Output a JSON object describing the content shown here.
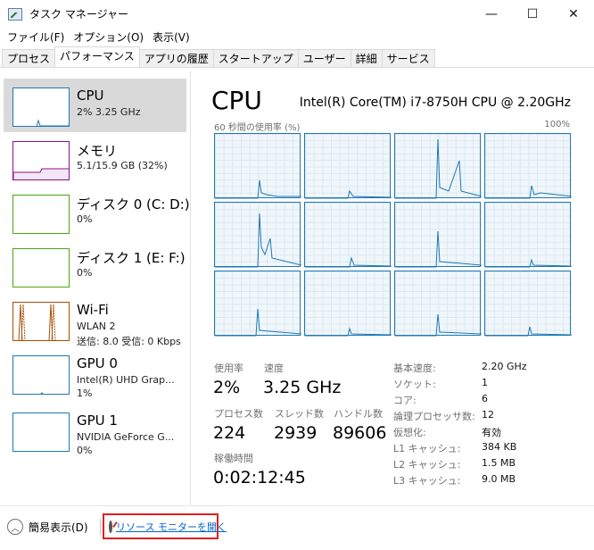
{
  "window": {
    "title": "タスク マネージャー",
    "minimize": "—",
    "maximize": "☐",
    "close": "✕"
  },
  "menu": [
    "ファイル(F)",
    "オプション(O)",
    "表示(V)"
  ],
  "tabs": [
    "プロセス",
    "パフォーマンス",
    "アプリの履歴",
    "スタートアップ",
    "ユーザー",
    "詳細",
    "サービス"
  ],
  "active_tab": "パフォーマンス",
  "resources": [
    {
      "name": "CPU",
      "sub1": "2%  3.25 GHz",
      "sub2": "",
      "color": "#1e78b4"
    },
    {
      "name": "メモリ",
      "sub1": "5.1/15.9 GB (32%)",
      "sub2": "",
      "color": "#8b128b"
    },
    {
      "name": "ディスク 0 (C: D:)",
      "sub1": "0%",
      "sub2": "",
      "color": "#4da60c"
    },
    {
      "name": "ディスク 1 (E: F:)",
      "sub1": "0%",
      "sub2": "",
      "color": "#4da60c"
    },
    {
      "name": "Wi-Fi",
      "sub1": "WLAN 2",
      "sub2": "送信: 8.0  受信: 0 Kbps",
      "color": "#a74f01"
    },
    {
      "name": "GPU 0",
      "sub1": "Intel(R) UHD Grap...",
      "sub2": "1%",
      "color": "#1e78b4"
    },
    {
      "name": "GPU 1",
      "sub1": "NVIDIA GeForce G...",
      "sub2": "0%",
      "color": "#1e78b4"
    }
  ],
  "main": {
    "title": "CPU",
    "model": "Intel(R) Core(TM) i7-8750H CPU @ 2.20GHz",
    "chart_label": "60 秒間の使用率 (%)",
    "chart_max": "100%"
  },
  "stats": {
    "usage_label": "使用率",
    "usage_value": "2%",
    "speed_label": "速度",
    "speed_value": "3.25 GHz",
    "processes_label": "プロセス数",
    "processes_value": "224",
    "threads_label": "スレッド数",
    "threads_value": "2939",
    "handles_label": "ハンドル数",
    "handles_value": "89606",
    "uptime_label": "稼働時間",
    "uptime_value": "0:02:12:45"
  },
  "info": [
    {
      "label": "基本速度:",
      "value": "2.20 GHz"
    },
    {
      "label": "ソケット:",
      "value": "1"
    },
    {
      "label": "コア:",
      "value": "6"
    },
    {
      "label": "論理プロセッサ数:",
      "value": "12"
    },
    {
      "label": "仮想化:",
      "value": "有効"
    },
    {
      "label": "L1 キャッシュ:",
      "value": "384 KB"
    },
    {
      "label": "L2 キャッシュ:",
      "value": "1.5 MB"
    },
    {
      "label": "L3 キャッシュ:",
      "value": "9.0 MB"
    }
  ],
  "bottom": {
    "fewer_details": "簡易表示(D)",
    "open_resmon": "リソース モニターを開く"
  }
}
